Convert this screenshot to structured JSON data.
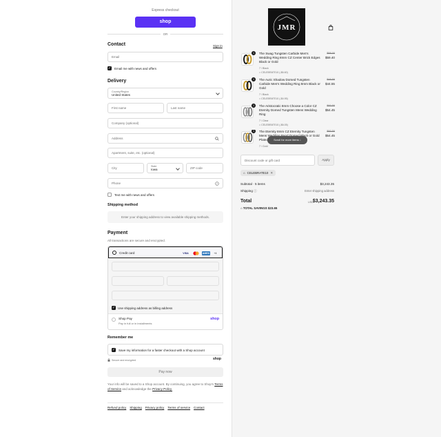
{
  "express": {
    "title": "Express checkout",
    "shop_label": "shop",
    "or": "OR"
  },
  "contact": {
    "heading": "Contact",
    "sign_in": "Sign in",
    "email_placeholder": "Email",
    "email_news": "Email me with news and offers"
  },
  "delivery": {
    "heading": "Delivery",
    "country_label": "Country/Region",
    "country_value": "United States",
    "first_name": "First name",
    "last_name": "Last name",
    "company": "Company (optional)",
    "address": "Address",
    "apartment": "Apartment, suite, etc. (optional)",
    "city": "City",
    "state_label": "State",
    "state_value": "Iowa",
    "zip": "ZIP code",
    "phone": "Phone",
    "text_news": "Text me with news and offers"
  },
  "shipping": {
    "heading": "Shipping method",
    "notice": "Enter your shipping address to view available shipping methods."
  },
  "payment": {
    "heading": "Payment",
    "subtitle": "All transactions are secure and encrypted.",
    "credit_card": "Credit card",
    "brands": [
      "VISA",
      "MC",
      "AMEX",
      "+4"
    ],
    "billing_same": "Use shipping address as billing address",
    "shop_pay": "Shop Pay",
    "shop_pay_sub": "Pay in full or in installments",
    "shop_pay_logo": "shop"
  },
  "remember": {
    "heading": "Remember me",
    "save_info": "Save my information for a faster checkout with a Shop account",
    "secure": "Secure and encrypted",
    "shop_logo": "shop"
  },
  "pay_now": "Pay now",
  "legal": {
    "line1": "Your info will be saved to a Shop account. By continuing, you agree to Shop's",
    "terms": "Terms of Service",
    "and": "and acknowledge the",
    "privacy": "Privacy Policy."
  },
  "footer": [
    "Refund policy",
    "Shipping",
    "Privacy policy",
    "Terms of service",
    "Contact"
  ],
  "store_logo": {
    "initials": "JMR"
  },
  "products": [
    {
      "qty": "1",
      "name": "The Swag Tungsten Carbide Men's Wedding Ring 8mm CZ Center Brick Edges Black or Gold",
      "variant": "7 / Black",
      "discount": "CELEBRATE10 (-$6.60)",
      "old_price": "$66.00",
      "price": "$59.40"
    },
    {
      "qty": "1",
      "name": "The Auric Shadow Domed Tungsten Carbide Men's Wedding Ring 8mm Black or Gold",
      "variant": "7 / Black",
      "discount": "CELEBRATE10 (-$4.95)",
      "old_price": "$49.50",
      "price": "$44.55"
    },
    {
      "qty": "1",
      "name": "The Aristocratic 8mm Choose a Color CZ Eternity Domed Tungsten Mens Wedding Ring",
      "variant": "7 / Clear",
      "discount": "CELEBRATE10 (-$6.05)",
      "old_price": "$60.50",
      "price": "$54.45"
    },
    {
      "qty": "1",
      "name": "The Eternity 8mm CZ Eternity Tungsten Mens Wedding Band Domed Black or Gold Plated",
      "variant": "7 / Gold",
      "discount": "",
      "old_price": "$60.50",
      "price": "$54.45"
    }
  ],
  "scroll_tip": "Scroll for more items",
  "discount": {
    "placeholder": "Discount code or gift card",
    "apply": "Apply",
    "applied_code": "CELEBRATE10"
  },
  "summary": {
    "subtotal_label": "Subtotal · 5 items",
    "subtotal_value": "$3,243.35",
    "shipping_label": "Shipping",
    "shipping_value": "Enter shipping address",
    "total_label": "Total",
    "currency": "USD",
    "total_value": "$3,243.35",
    "savings_label": "TOTAL SAVINGS",
    "savings_value": "$23.65"
  }
}
